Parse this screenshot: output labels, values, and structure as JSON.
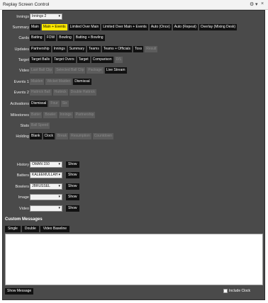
{
  "window": {
    "title": "Replay Screen Control",
    "controls": [
      "⚙",
      "▾",
      "×"
    ]
  },
  "innings": {
    "label": "Innings",
    "value": "Innings 2"
  },
  "rows": [
    {
      "id": "summary",
      "label": "Summary",
      "buttons": [
        {
          "text": "Main",
          "state": "on"
        },
        {
          "text": "Main + Events",
          "state": "highlight"
        },
        {
          "text": "Limited Over Main",
          "state": "on"
        },
        {
          "text": "Limited Over Main + Events",
          "state": "on"
        },
        {
          "text": "Auto (Once)",
          "state": "on"
        },
        {
          "text": "Auto (Repeat)",
          "state": "on"
        },
        {
          "text": "Overlay (Mixing Desk)",
          "state": "on"
        }
      ]
    },
    {
      "id": "cards",
      "label": "Cards",
      "buttons": [
        {
          "text": "Batting",
          "state": "on"
        },
        {
          "text": "FOW",
          "state": "on"
        },
        {
          "text": "Bowling",
          "state": "on"
        },
        {
          "text": "Batting + Bowling",
          "state": "on"
        }
      ]
    },
    {
      "id": "updates",
      "label": "Updates",
      "buttons": [
        {
          "text": "Partnership",
          "state": "on"
        },
        {
          "text": "Innings",
          "state": "on"
        },
        {
          "text": "Summary",
          "state": "on"
        },
        {
          "text": "Teams",
          "state": "on"
        },
        {
          "text": "Teams + Officials",
          "state": "on"
        },
        {
          "text": "Toss",
          "state": "on"
        },
        {
          "text": "Result",
          "state": "off"
        }
      ]
    },
    {
      "id": "target",
      "label": "Target",
      "buttons": [
        {
          "text": "Target Balls",
          "state": "on"
        },
        {
          "text": "Target Overs",
          "state": "on"
        },
        {
          "text": "Target",
          "state": "on"
        },
        {
          "text": "Comparison",
          "state": "on"
        },
        {
          "text": "D/L",
          "state": "off"
        }
      ]
    },
    {
      "id": "video",
      "label": "Video",
      "buttons": [
        {
          "text": "Last Ball Clip",
          "state": "off"
        },
        {
          "text": "Selected Ball Clip",
          "state": "off"
        },
        {
          "text": "Package",
          "state": "off"
        },
        {
          "text": "Live Stream",
          "state": "on"
        }
      ]
    },
    {
      "id": "events1",
      "label": "Events 1",
      "buttons": [
        {
          "text": "Maiden",
          "state": "off"
        },
        {
          "text": "Wicket Maiden",
          "state": "off"
        },
        {
          "text": "Dismissal",
          "state": "on"
        }
      ]
    },
    {
      "id": "events2",
      "label": "Events 2",
      "buttons": [
        {
          "text": "Hattrick Ball",
          "state": "off"
        },
        {
          "text": "Hattrick",
          "state": "off"
        },
        {
          "text": "Double Hattrick",
          "state": "off"
        }
      ]
    },
    {
      "id": "activations",
      "label": "Activations",
      "buttons": [
        {
          "text": "Dismissal",
          "state": "on"
        },
        {
          "text": "Four",
          "state": "off"
        },
        {
          "text": "Six",
          "state": "off"
        }
      ]
    },
    {
      "id": "milestones",
      "label": "Milestones",
      "buttons": [
        {
          "text": "Batter",
          "state": "off"
        },
        {
          "text": "Bowler",
          "state": "off"
        },
        {
          "text": "Innings",
          "state": "off"
        },
        {
          "text": "Partnership",
          "state": "off"
        }
      ]
    },
    {
      "id": "stats",
      "label": "Stats",
      "buttons": [
        {
          "text": "Ball Speed",
          "state": "off"
        }
      ]
    },
    {
      "id": "holding",
      "label": "Holding",
      "buttons": [
        {
          "text": "Blank",
          "state": "on"
        },
        {
          "text": "Clock",
          "state": "on"
        },
        {
          "text": "Break",
          "state": "off"
        },
        {
          "text": "Resumption",
          "state": "off"
        },
        {
          "text": "Countdown",
          "state": "off"
        }
      ]
    }
  ],
  "selectors": [
    {
      "id": "history",
      "label": "History",
      "value": "OMAN 150",
      "show": "Show"
    },
    {
      "id": "batters",
      "label": "Batters",
      "value": "KALEEMULLAH",
      "show": "Show"
    },
    {
      "id": "bowlers",
      "label": "Bowlers",
      "value": "JBRUSSEL",
      "show": "Show"
    },
    {
      "id": "image",
      "label": "Image",
      "value": "",
      "show": "Show"
    },
    {
      "id": "video2",
      "label": "Video",
      "value": "",
      "show": "Show"
    }
  ],
  "custom": {
    "title": "Custom Messages",
    "tabs": [
      "Single",
      "Double",
      "Video Baseline"
    ],
    "show_message": "Show Message",
    "include_clock": "Include Clock"
  }
}
